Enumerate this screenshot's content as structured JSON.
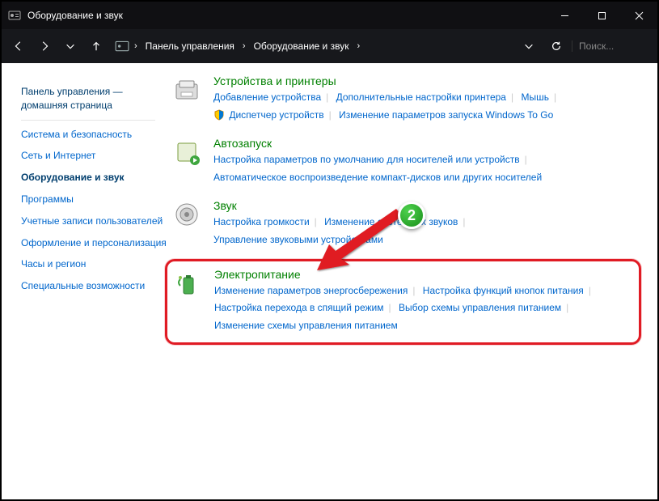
{
  "window": {
    "title": "Оборудование и звук"
  },
  "breadcrumb": {
    "root": "Панель управления",
    "current": "Оборудование и звук"
  },
  "search": {
    "placeholder": "Поиск..."
  },
  "sidebar": {
    "home1": "Панель управления —",
    "home2": "домашняя страница",
    "items": [
      "Система и безопасность",
      "Сеть и Интернет",
      "Оборудование и звук",
      "Программы",
      "Учетные записи пользователей",
      "Оформление и персонализация",
      "Часы и регион",
      "Специальные возможности"
    ]
  },
  "categories": [
    {
      "title": "Устройства и принтеры",
      "links": [
        "Добавление устройства",
        "Дополнительные настройки принтера",
        "Мышь",
        "Диспетчер устройств",
        "Изменение параметров запуска Windows To Go"
      ],
      "shieldIdx": [
        3
      ]
    },
    {
      "title": "Автозапуск",
      "links": [
        "Настройка параметров по умолчанию для носителей или устройств",
        "Автоматическое воспроизведение компакт-дисков или других носителей"
      ]
    },
    {
      "title": "Звук",
      "links": [
        "Настройка громкости",
        "Изменение системных звуков",
        "Управление звуковыми устройствами"
      ]
    },
    {
      "title": "Электропитание",
      "links": [
        "Изменение параметров энергосбережения",
        "Настройка функций кнопок питания",
        "Настройка перехода в спящий режим",
        "Выбор схемы управления питанием",
        "Изменение схемы управления питанием"
      ],
      "highlight": true
    }
  ],
  "annotation": {
    "badge": "2"
  }
}
